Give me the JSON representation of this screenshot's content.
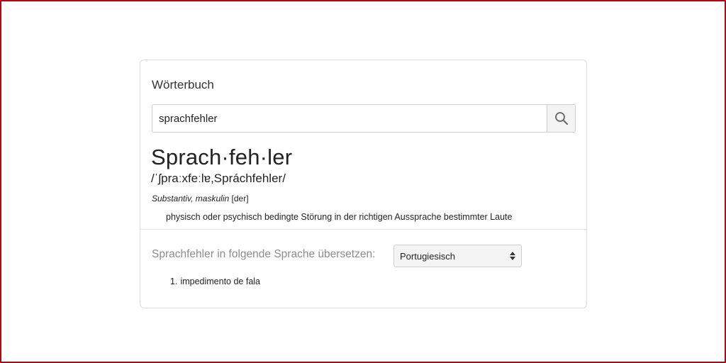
{
  "dictionary": {
    "title": "Wörterbuch",
    "search": {
      "value": "sprachfehler",
      "icon": "search-icon"
    }
  },
  "entry": {
    "headword": "Sprach·feh·ler",
    "pronunciation": "/ˈʃpraːxfeːlɐ,Spráchfehler/",
    "part_of_speech": "Substantiv, maskulin",
    "article": "[der]",
    "definition": "physisch oder psychisch bedingte Störung in der richtigen Aussprache bestimmter Laute"
  },
  "translation": {
    "label": "Sprachfehler in folgende Sprache übersetzen:",
    "selected_language": "Portugiesisch",
    "results": [
      {
        "number": "1.",
        "text": "impedimento de fala"
      }
    ]
  },
  "colors": {
    "frame_border": "#a30f14",
    "muted_text": "#8c8c8c"
  }
}
